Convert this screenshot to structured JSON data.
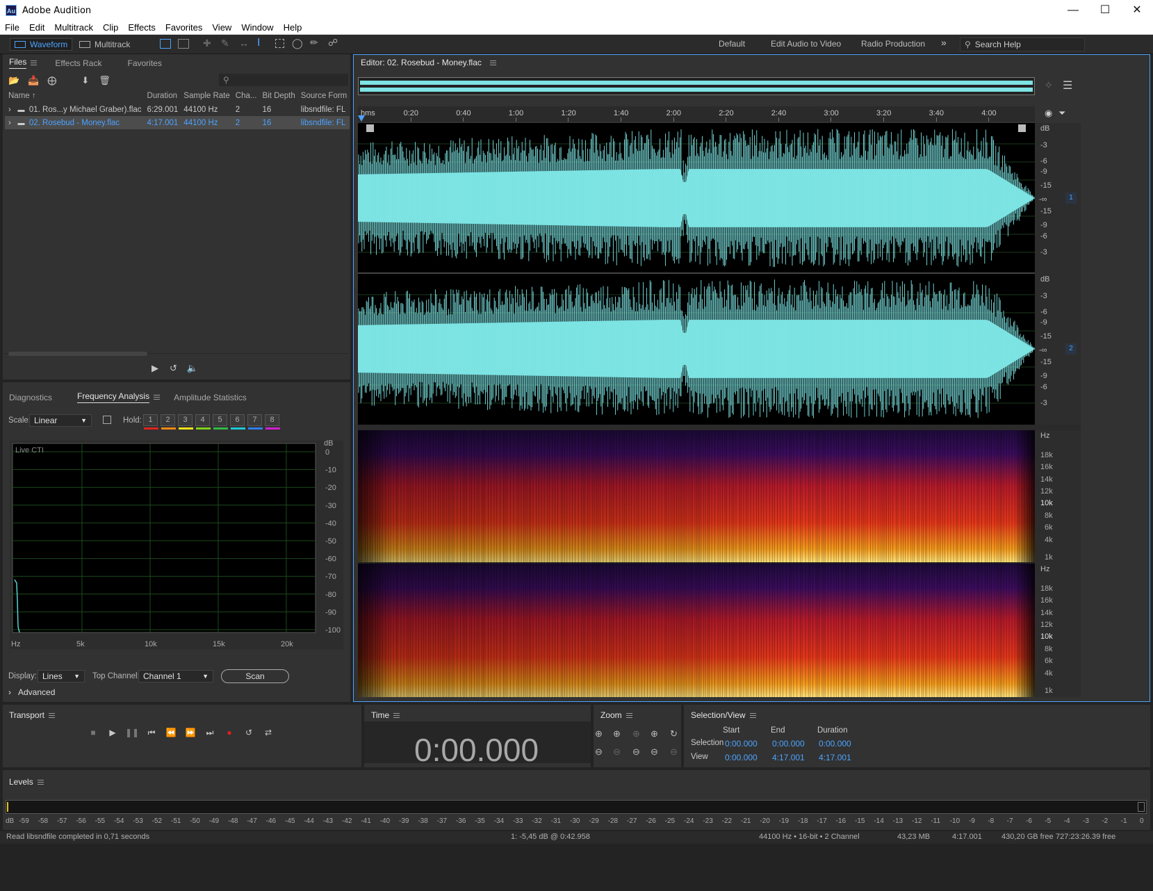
{
  "window": {
    "title": "Adobe Audition",
    "logo": "Au"
  },
  "menu": [
    "File",
    "Edit",
    "Multitrack",
    "Clip",
    "Effects",
    "Favorites",
    "View",
    "Window",
    "Help"
  ],
  "toolbar": {
    "waveform_label": "Waveform",
    "multitrack_label": "Multitrack",
    "workspaces": [
      "Default",
      "Edit Audio to Video",
      "Radio Production"
    ],
    "search_placeholder": "Search Help"
  },
  "files_panel": {
    "tabs": [
      "Files",
      "Effects Rack",
      "Favorites"
    ],
    "columns": [
      "Name",
      "Duration",
      "Sample Rate",
      "Cha...",
      "Bit Depth",
      "Source Form"
    ],
    "rows": [
      {
        "name": "01. Ros...y Michael Graber).flac",
        "duration": "6:29.001",
        "rate": "44100 Hz",
        "ch": "2",
        "bits": "16",
        "source": "libsndfile: FL"
      },
      {
        "name": "02. Rosebud - Money.flac",
        "duration": "4:17.001",
        "rate": "44100 Hz",
        "ch": "2",
        "bits": "16",
        "source": "libsndfile: FL"
      }
    ]
  },
  "analysis_panel": {
    "tabs": [
      "Diagnostics",
      "Frequency Analysis",
      "Amplitude Statistics"
    ],
    "scale_label": "Scale:",
    "scale_value": "Linear",
    "hold_label": "Hold:",
    "holds": [
      "1",
      "2",
      "3",
      "4",
      "5",
      "6",
      "7",
      "8"
    ],
    "hold_colors": [
      "#e0231d",
      "#f08a12",
      "#f2e21a",
      "#7fd21a",
      "#33b84a",
      "#1ec9d6",
      "#2e7ef0",
      "#d21fd2"
    ],
    "graph_caption": "Live CTI",
    "db_unit": "dB",
    "db_ticks": [
      "0",
      "-10",
      "-20",
      "-30",
      "-40",
      "-50",
      "-60",
      "-70",
      "-80",
      "-90",
      "-100"
    ],
    "hz_ticks": [
      "Hz",
      "5k",
      "10k",
      "15k",
      "20k"
    ],
    "display_label": "Display:",
    "display_value": "Lines",
    "topch_label": "Top Channel:",
    "topch_value": "Channel 1",
    "scan_label": "Scan",
    "advanced_label": "Advanced"
  },
  "editor": {
    "title": "Editor: 02. Rosebud - Money.flac",
    "ruler_unit": "hms",
    "ruler_ticks": [
      "0:20",
      "0:40",
      "1:00",
      "1:20",
      "1:40",
      "2:00",
      "2:20",
      "2:40",
      "3:00",
      "3:20",
      "3:40",
      "4:00"
    ],
    "wave_db_unit": "dB",
    "wave_db_ticks": [
      "-3",
      "-6",
      "-9",
      "-15",
      "-∞",
      "-15",
      "-9",
      "-6",
      "-3"
    ],
    "channels": [
      "1",
      "2"
    ],
    "spec_unit": "Hz",
    "spec_ticks": [
      "18k",
      "16k",
      "14k",
      "12k",
      "10k",
      "8k",
      "6k",
      "4k",
      "1k"
    ],
    "wave_color": "#7de3e3",
    "accent": "#4da3ff"
  },
  "transport": {
    "title": "Transport"
  },
  "time_panel": {
    "title": "Time",
    "value": "0:00.000"
  },
  "zoom_panel": {
    "title": "Zoom"
  },
  "selview": {
    "title": "Selection/View",
    "headers": [
      "Start",
      "End",
      "Duration"
    ],
    "selection_label": "Selection",
    "view_label": "View",
    "selection": [
      "0:00.000",
      "0:00.000",
      "0:00.000"
    ],
    "view": [
      "0:00.000",
      "4:17.001",
      "4:17.001"
    ]
  },
  "levels": {
    "title": "Levels",
    "ticks": [
      "dB",
      "-59",
      "-58",
      "-57",
      "-56",
      "-55",
      "-54",
      "-53",
      "-52",
      "-51",
      "-50",
      "-49",
      "-48",
      "-47",
      "-46",
      "-45",
      "-44",
      "-43",
      "-42",
      "-41",
      "-40",
      "-39",
      "-38",
      "-37",
      "-36",
      "-35",
      "-34",
      "-33",
      "-32",
      "-31",
      "-30",
      "-29",
      "-28",
      "-27",
      "-26",
      "-25",
      "-24",
      "-23",
      "-22",
      "-21",
      "-20",
      "-19",
      "-18",
      "-17",
      "-16",
      "-15",
      "-14",
      "-13",
      "-12",
      "-11",
      "-10",
      "-9",
      "-8",
      "-7",
      "-6",
      "-5",
      "-4",
      "-3",
      "-2",
      "-1",
      "0"
    ]
  },
  "status": {
    "left": "Read libsndfile completed in 0,71 seconds",
    "cursor": "1: -5,45 dB @ 0:42.958",
    "format": "44100 Hz • 16-bit • 2 Channel",
    "size": "43,23 MB",
    "duration": "4:17.001",
    "free": "430,20 GB free",
    "free_time": "727:23:26.39 free"
  }
}
